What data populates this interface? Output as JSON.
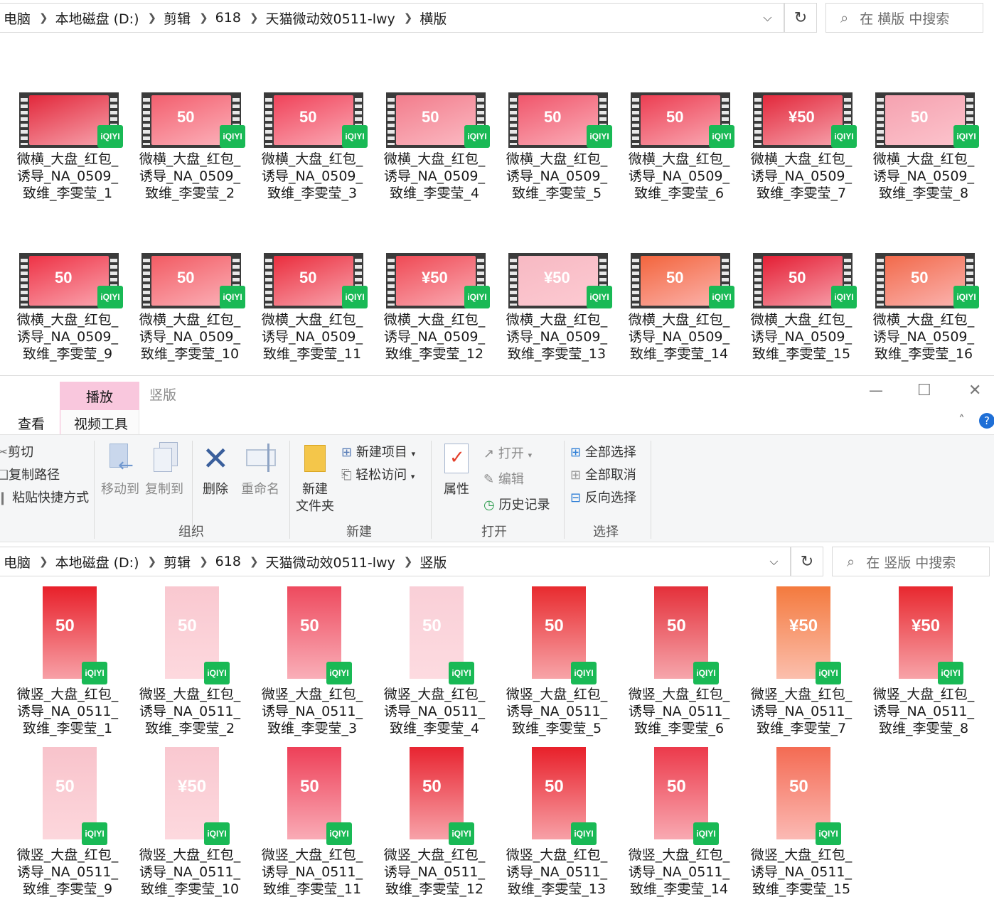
{
  "colors": {
    "accent_pink": "#f9c7dd",
    "iqiyi_green": "#19b955",
    "red": "#e8202a",
    "selection_blue": "#1f6fd6"
  },
  "top_window": {
    "breadcrumb": [
      "电脑",
      "本地磁盘 (D:)",
      "剪辑",
      "618",
      "天猫微动效0511-lwy",
      "横版"
    ],
    "search_placeholder": "在 横版 中搜索",
    "files": [
      {
        "label": "微横_大盘_红包_诱导_NA_0509_致维_李雯莹_1",
        "line1": "微横_大盘_红包_",
        "line2": "诱导_NA_0509_",
        "line3": "致维_李雯莹_1",
        "amount": "",
        "badge": "iQIYI",
        "color": "#e2283b"
      },
      {
        "label": "微横_大盘_红包_诱导_NA_0509_致维_李雯莹_2",
        "line1": "微横_大盘_红包_",
        "line2": "诱导_NA_0509_",
        "line3": "致维_李雯莹_2",
        "amount": "50",
        "badge": "iQIYI",
        "color": "#f35f6e"
      },
      {
        "label": "微横_大盘_红包_诱导_NA_0509_致维_李雯莹_3",
        "line1": "微横_大盘_红包_",
        "line2": "诱导_NA_0509_",
        "line3": "致维_李雯莹_3",
        "amount": "50",
        "badge": "iQIYI",
        "color": "#f0435a"
      },
      {
        "label": "微横_大盘_红包_诱导_NA_0509_致维_李雯莹_4",
        "line1": "微横_大盘_红包_",
        "line2": "诱导_NA_0509_",
        "line3": "致维_李雯莹_4",
        "amount": "50",
        "badge": "iQIYI",
        "color": "#f27d8c"
      },
      {
        "label": "微横_大盘_红包_诱导_NA_0509_致维_李雯莹_5",
        "line1": "微横_大盘_红包_",
        "line2": "诱导_NA_0509_",
        "line3": "致维_李雯莹_5",
        "amount": "50",
        "badge": "iQIYI",
        "color": "#f0566b"
      },
      {
        "label": "微横_大盘_红包_诱导_NA_0509_致维_李雯莹_6",
        "line1": "微横_大盘_红包_",
        "line2": "诱导_NA_0509_",
        "line3": "致维_李雯莹_6",
        "amount": "50",
        "badge": "iQIYI",
        "color": "#ec3e52"
      },
      {
        "label": "微横_大盘_红包_诱导_NA_0509_致维_李雯莹_7",
        "line1": "微横_大盘_红包_",
        "line2": "诱导_NA_0509_",
        "line3": "致维_李雯莹_7",
        "amount": "¥50",
        "badge": "iQIYI",
        "color": "#e2283b"
      },
      {
        "label": "微横_大盘_红包_诱导_NA_0509_致维_李雯莹_8",
        "line1": "微横_大盘_红包_",
        "line2": "诱导_NA_0509_",
        "line3": "致维_李雯莹_8",
        "amount": "50",
        "badge": "iQIYI",
        "color": "#f5a2b0"
      },
      {
        "label": "微横_大盘_红包_诱导_NA_0509_致维_李雯莹_9",
        "line1": "微横_大盘_红包_",
        "line2": "诱导_NA_0509_",
        "line3": "致维_李雯莹_9",
        "amount": "50",
        "badge": "iQIYI",
        "color": "#ee3346"
      },
      {
        "label": "微横_大盘_红包_诱导_NA_0509_致维_李雯莹_10",
        "line1": "微横_大盘_红包_",
        "line2": "诱导_NA_0509_",
        "line3": "致维_李雯莹_10",
        "amount": "50",
        "badge": "iQIYI",
        "color": "#f25b63"
      },
      {
        "label": "微横_大盘_红包_诱导_NA_0509_致维_李雯莹_11",
        "line1": "微横_大盘_红包_",
        "line2": "诱导_NA_0509_",
        "line3": "致维_李雯莹_11",
        "amount": "50",
        "badge": "iQIYI",
        "color": "#ea2e3e"
      },
      {
        "label": "微横_大盘_红包_诱导_NA_0509_致维_李雯莹_12",
        "line1": "微横_大盘_红包_",
        "line2": "诱导_NA_0509_",
        "line3": "致维_李雯莹_12",
        "amount": "¥50",
        "badge": "iQIYI",
        "color": "#ef4a55"
      },
      {
        "label": "微横_大盘_红包_诱导_NA_0509_致维_李雯莹_13",
        "line1": "微横_大盘_红包_",
        "line2": "诱导_NA_0509_",
        "line3": "致维_李雯莹_13",
        "amount": "¥50",
        "badge": "iQIYI",
        "color": "#f7b9c3"
      },
      {
        "label": "微横_大盘_红包_诱导_NA_0509_致维_李雯莹_14",
        "line1": "微横_大盘_红包_",
        "line2": "诱导_NA_0509_",
        "line3": "致维_李雯莹_14",
        "amount": "50",
        "badge": "iQIYI",
        "color": "#f3653d"
      },
      {
        "label": "微横_大盘_红包_诱导_NA_0509_致维_李雯莹_15",
        "line1": "微横_大盘_红包_",
        "line2": "诱导_NA_0509_",
        "line3": "致维_李雯莹_15",
        "amount": "50",
        "badge": "iQIYI",
        "color": "#e41e34"
      },
      {
        "label": "微横_大盘_红包_诱导_NA_0509_致维_李雯莹_16",
        "line1": "微横_大盘_红包_",
        "line2": "诱导_NA_0509_",
        "line3": "致维_李雯莹_16",
        "amount": "50",
        "badge": "iQIYI",
        "color": "#f26a4b"
      }
    ]
  },
  "bottom_window": {
    "tabs": {
      "context_tab": "播放",
      "folder_title": "竖版",
      "view_tab": "查看",
      "video_tools_tab": "视频工具"
    },
    "ribbon": {
      "clipboard": {
        "cut": "剪切",
        "copy_path": "复制路径",
        "paste_shortcut": "粘贴快捷方式"
      },
      "organize": {
        "move_to": "移动到",
        "copy_to": "复制到",
        "delete": "删除",
        "rename": "重命名",
        "group": "组织"
      },
      "new": {
        "new_folder_1": "新建",
        "new_folder_2": "文件夹",
        "new_item": "新建项目",
        "easy_access": "轻松访问",
        "group": "新建"
      },
      "open": {
        "properties": "属性",
        "open": "打开",
        "edit": "编辑",
        "history": "历史记录",
        "group": "打开"
      },
      "select": {
        "select_all": "全部选择",
        "select_none": "全部取消",
        "invert": "反向选择",
        "group": "选择"
      }
    },
    "breadcrumb": [
      "电脑",
      "本地磁盘 (D:)",
      "剪辑",
      "618",
      "天猫微动效0511-lwy",
      "竖版"
    ],
    "search_placeholder": "在 竖版 中搜索",
    "files": [
      {
        "label": "微竖_大盘_红包_诱导_NA_0511_致维_李雯莹_1",
        "line1": "微竖_大盘_红包_",
        "line2": "诱导_NA_0511_",
        "line3": "致维_李雯莹_1",
        "amount": "50",
        "badge": "iQIYI",
        "color": "#e8202a"
      },
      {
        "label": "微竖_大盘_红包_诱导_NA_0511_致维_李雯莹_2",
        "line1": "微竖_大盘_红包_",
        "line2": "诱导_NA_0511_",
        "line3": "致维_李雯莹_2",
        "amount": "50",
        "badge": "iQIYI",
        "color": "#f9c8d0"
      },
      {
        "label": "微竖_大盘_红包_诱导_NA_0511_致维_李雯莹_3",
        "line1": "微竖_大盘_红包_",
        "line2": "诱导_NA_0511_",
        "line3": "致维_李雯莹_3",
        "amount": "50",
        "badge": "iQIYI",
        "color": "#ee4a5e"
      },
      {
        "label": "微竖_大盘_红包_诱导_NA_0511_致维_李雯莹_4",
        "line1": "微竖_大盘_红包_",
        "line2": "诱导_NA_0511_",
        "line3": "致维_李雯莹_4",
        "amount": "50",
        "badge": "iQIYI",
        "color": "#f9cfd7"
      },
      {
        "label": "微竖_大盘_红包_诱导_NA_0511_致维_李雯莹_5",
        "line1": "微竖_大盘_红包_",
        "line2": "诱导_NA_0511_",
        "line3": "致维_李雯莹_5",
        "amount": "50",
        "badge": "iQIYI",
        "color": "#e82b2f"
      },
      {
        "label": "微竖_大盘_红包_诱导_NA_0511_致维_李雯莹_6",
        "line1": "微竖_大盘_红包_",
        "line2": "诱导_NA_0511_",
        "line3": "致维_李雯莹_6",
        "amount": "50",
        "badge": "iQIYI",
        "color": "#e4303a"
      },
      {
        "label": "微竖_大盘_红包_诱导_NA_0511_致维_李雯莹_7",
        "line1": "微竖_大盘_红包_",
        "line2": "诱导_NA_0511_",
        "line3": "致维_李雯莹_7",
        "amount": "¥50",
        "badge": "iQIYI",
        "color": "#f47a3e"
      },
      {
        "label": "微竖_大盘_红包_诱导_NA_0511_致维_李雯莹_8",
        "line1": "微竖_大盘_红包_",
        "line2": "诱导_NA_0511_",
        "line3": "致维_李雯莹_8",
        "amount": "¥50",
        "badge": "iQIYI",
        "color": "#e8282f"
      },
      {
        "label": "微竖_大盘_红包_诱导_NA_0511_致维_李雯莹_9",
        "line1": "微竖_大盘_红包_",
        "line2": "诱导_NA_0511_",
        "line3": "致维_李雯莹_9",
        "amount": "50",
        "badge": "iQIYI",
        "color": "#f8c3cb"
      },
      {
        "label": "微竖_大盘_红包_诱导_NA_0511_致维_李雯莹_10",
        "line1": "微竖_大盘_红包_",
        "line2": "诱导_NA_0511_",
        "line3": "致维_李雯莹_10",
        "amount": "¥50",
        "badge": "iQIYI",
        "color": "#f9c8d0"
      },
      {
        "label": "微竖_大盘_红包_诱导_NA_0511_致维_李雯莹_11",
        "line1": "微竖_大盘_红包_",
        "line2": "诱导_NA_0511_",
        "line3": "致维_李雯莹_11",
        "amount": "50",
        "badge": "iQIYI",
        "color": "#ee4058"
      },
      {
        "label": "微竖_大盘_红包_诱导_NA_0511_致维_李雯莹_12",
        "line1": "微竖_大盘_红包_",
        "line2": "诱导_NA_0511_",
        "line3": "致维_李雯莹_12",
        "amount": "50",
        "badge": "iQIYI",
        "color": "#e82531"
      },
      {
        "label": "微竖_大盘_红包_诱导_NA_0511_致维_李雯莹_13",
        "line1": "微竖_大盘_红包_",
        "line2": "诱导_NA_0511_",
        "line3": "致维_李雯莹_13",
        "amount": "50",
        "badge": "iQIYI",
        "color": "#e8202a"
      },
      {
        "label": "微竖_大盘_红包_诱导_NA_0511_致维_李雯莹_14",
        "line1": "微竖_大盘_红包_",
        "line2": "诱导_NA_0511_",
        "line3": "致维_李雯莹_14",
        "amount": "50",
        "badge": "iQIYI",
        "color": "#ec3a4b"
      },
      {
        "label": "微竖_大盘_红包_诱导_NA_0511_致维_李雯莹_15",
        "line1": "微竖_大盘_红包_",
        "line2": "诱导_NA_0511_",
        "line3": "致维_李雯莹_15",
        "amount": "50",
        "badge": "iQIYI",
        "color": "#f46b53"
      }
    ]
  }
}
